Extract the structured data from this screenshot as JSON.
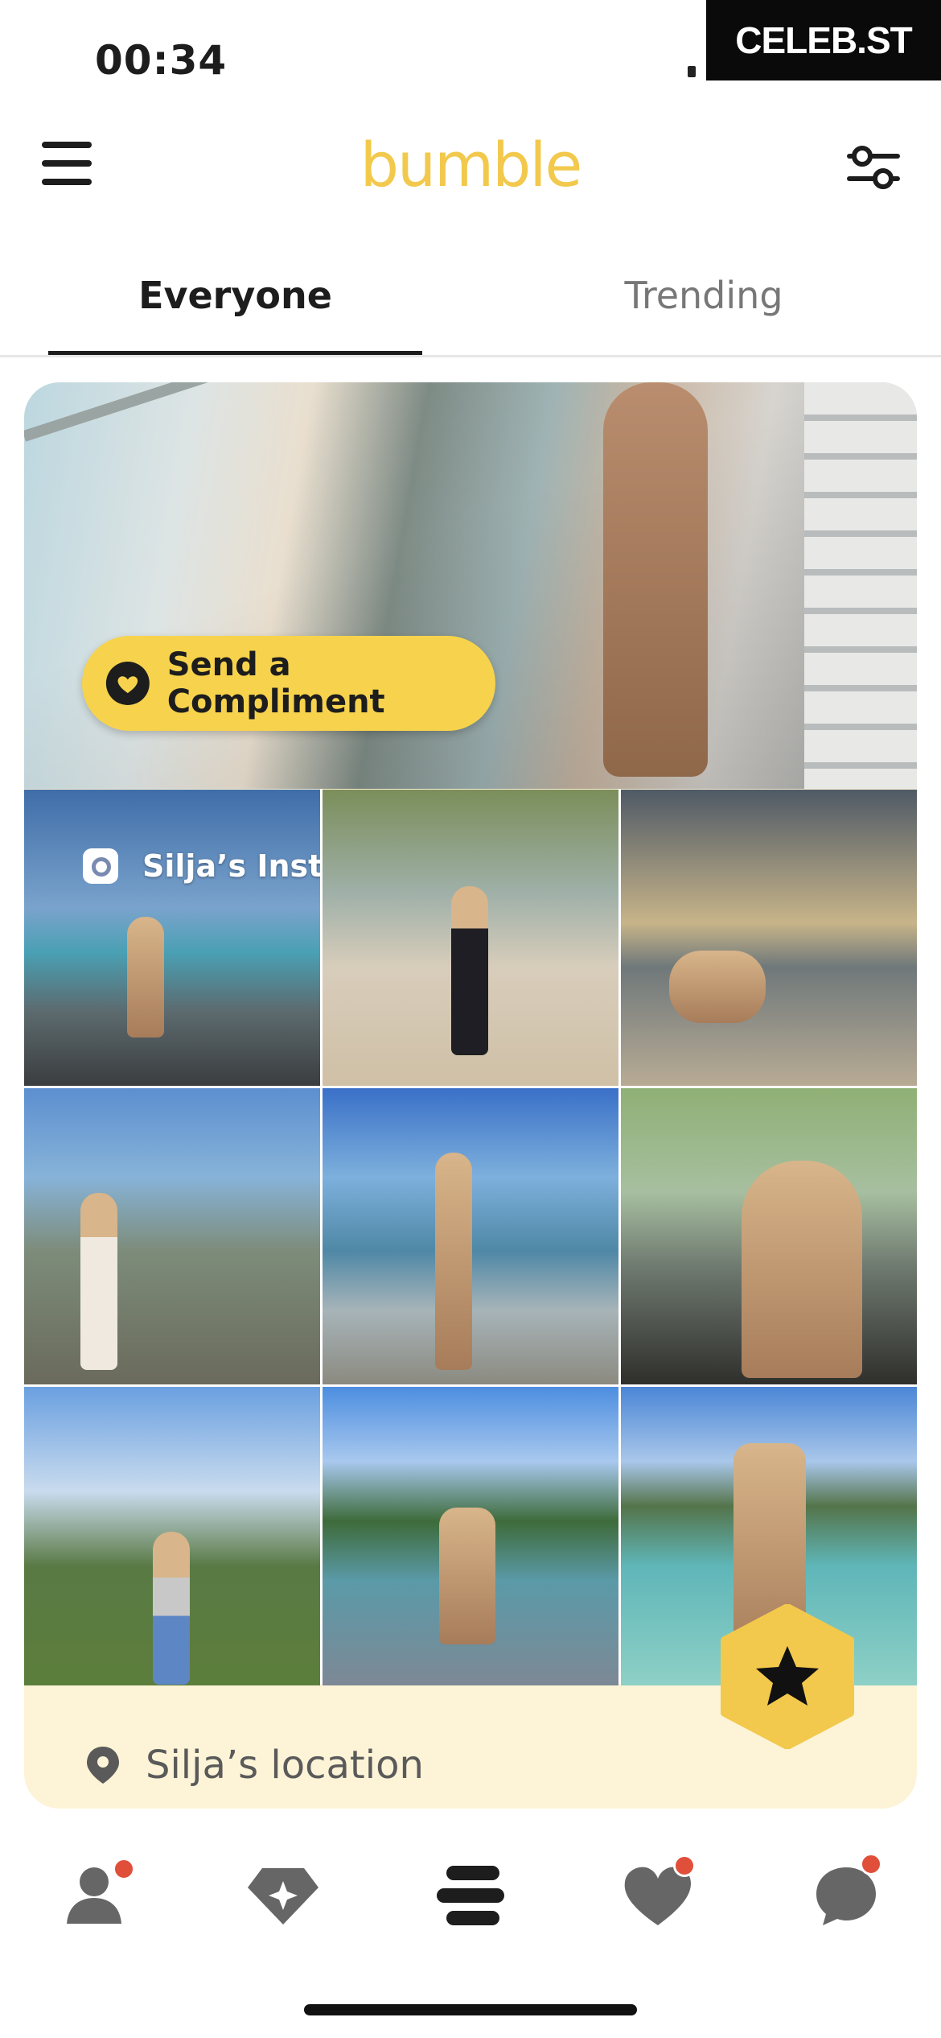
{
  "status_bar": {
    "time": "00:34"
  },
  "watermark": {
    "text": "CELEB.ST"
  },
  "header": {
    "logo": "bumble",
    "menu_icon": "hamburger-menu-icon",
    "filter_icon": "filter-sliders-icon"
  },
  "tabs": [
    {
      "label": "Everyone",
      "selected": true
    },
    {
      "label": "Trending",
      "selected": false
    }
  ],
  "profile_card": {
    "compliment_button": "Send a Compliment",
    "instagram_label": "Silja’s Instagram",
    "location_label": "Silja’s location",
    "superswipe_icon": "star-icon"
  },
  "bottom_nav": [
    {
      "icon": "profile-icon",
      "badge": true
    },
    {
      "icon": "diamond-sparkle-icon",
      "badge": false
    },
    {
      "icon": "discover-stack-icon",
      "badge": false,
      "active": true
    },
    {
      "icon": "heart-icon",
      "badge": true
    },
    {
      "icon": "chat-bubble-icon",
      "badge": true
    }
  ],
  "colors": {
    "brand_yellow": "#f2c94c",
    "button_yellow": "#f7d34d",
    "badge_red": "#e04f3a",
    "location_bg": "#fdf4d7"
  }
}
